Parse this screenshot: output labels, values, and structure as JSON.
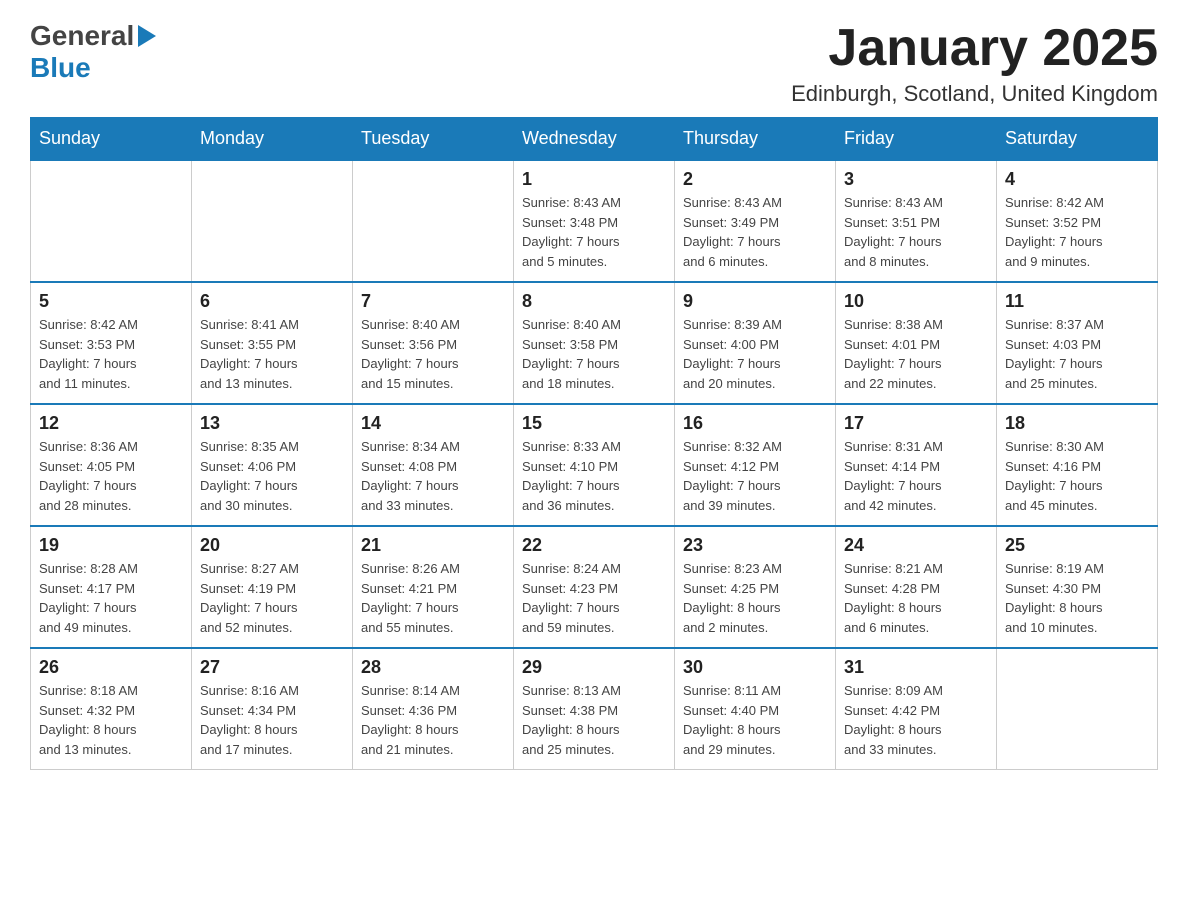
{
  "header": {
    "logo_general": "General",
    "logo_blue": "Blue",
    "title": "January 2025",
    "subtitle": "Edinburgh, Scotland, United Kingdom"
  },
  "days_of_week": [
    "Sunday",
    "Monday",
    "Tuesday",
    "Wednesday",
    "Thursday",
    "Friday",
    "Saturday"
  ],
  "weeks": [
    [
      {
        "day": "",
        "info": ""
      },
      {
        "day": "",
        "info": ""
      },
      {
        "day": "",
        "info": ""
      },
      {
        "day": "1",
        "info": "Sunrise: 8:43 AM\nSunset: 3:48 PM\nDaylight: 7 hours\nand 5 minutes."
      },
      {
        "day": "2",
        "info": "Sunrise: 8:43 AM\nSunset: 3:49 PM\nDaylight: 7 hours\nand 6 minutes."
      },
      {
        "day": "3",
        "info": "Sunrise: 8:43 AM\nSunset: 3:51 PM\nDaylight: 7 hours\nand 8 minutes."
      },
      {
        "day": "4",
        "info": "Sunrise: 8:42 AM\nSunset: 3:52 PM\nDaylight: 7 hours\nand 9 minutes."
      }
    ],
    [
      {
        "day": "5",
        "info": "Sunrise: 8:42 AM\nSunset: 3:53 PM\nDaylight: 7 hours\nand 11 minutes."
      },
      {
        "day": "6",
        "info": "Sunrise: 8:41 AM\nSunset: 3:55 PM\nDaylight: 7 hours\nand 13 minutes."
      },
      {
        "day": "7",
        "info": "Sunrise: 8:40 AM\nSunset: 3:56 PM\nDaylight: 7 hours\nand 15 minutes."
      },
      {
        "day": "8",
        "info": "Sunrise: 8:40 AM\nSunset: 3:58 PM\nDaylight: 7 hours\nand 18 minutes."
      },
      {
        "day": "9",
        "info": "Sunrise: 8:39 AM\nSunset: 4:00 PM\nDaylight: 7 hours\nand 20 minutes."
      },
      {
        "day": "10",
        "info": "Sunrise: 8:38 AM\nSunset: 4:01 PM\nDaylight: 7 hours\nand 22 minutes."
      },
      {
        "day": "11",
        "info": "Sunrise: 8:37 AM\nSunset: 4:03 PM\nDaylight: 7 hours\nand 25 minutes."
      }
    ],
    [
      {
        "day": "12",
        "info": "Sunrise: 8:36 AM\nSunset: 4:05 PM\nDaylight: 7 hours\nand 28 minutes."
      },
      {
        "day": "13",
        "info": "Sunrise: 8:35 AM\nSunset: 4:06 PM\nDaylight: 7 hours\nand 30 minutes."
      },
      {
        "day": "14",
        "info": "Sunrise: 8:34 AM\nSunset: 4:08 PM\nDaylight: 7 hours\nand 33 minutes."
      },
      {
        "day": "15",
        "info": "Sunrise: 8:33 AM\nSunset: 4:10 PM\nDaylight: 7 hours\nand 36 minutes."
      },
      {
        "day": "16",
        "info": "Sunrise: 8:32 AM\nSunset: 4:12 PM\nDaylight: 7 hours\nand 39 minutes."
      },
      {
        "day": "17",
        "info": "Sunrise: 8:31 AM\nSunset: 4:14 PM\nDaylight: 7 hours\nand 42 minutes."
      },
      {
        "day": "18",
        "info": "Sunrise: 8:30 AM\nSunset: 4:16 PM\nDaylight: 7 hours\nand 45 minutes."
      }
    ],
    [
      {
        "day": "19",
        "info": "Sunrise: 8:28 AM\nSunset: 4:17 PM\nDaylight: 7 hours\nand 49 minutes."
      },
      {
        "day": "20",
        "info": "Sunrise: 8:27 AM\nSunset: 4:19 PM\nDaylight: 7 hours\nand 52 minutes."
      },
      {
        "day": "21",
        "info": "Sunrise: 8:26 AM\nSunset: 4:21 PM\nDaylight: 7 hours\nand 55 minutes."
      },
      {
        "day": "22",
        "info": "Sunrise: 8:24 AM\nSunset: 4:23 PM\nDaylight: 7 hours\nand 59 minutes."
      },
      {
        "day": "23",
        "info": "Sunrise: 8:23 AM\nSunset: 4:25 PM\nDaylight: 8 hours\nand 2 minutes."
      },
      {
        "day": "24",
        "info": "Sunrise: 8:21 AM\nSunset: 4:28 PM\nDaylight: 8 hours\nand 6 minutes."
      },
      {
        "day": "25",
        "info": "Sunrise: 8:19 AM\nSunset: 4:30 PM\nDaylight: 8 hours\nand 10 minutes."
      }
    ],
    [
      {
        "day": "26",
        "info": "Sunrise: 8:18 AM\nSunset: 4:32 PM\nDaylight: 8 hours\nand 13 minutes."
      },
      {
        "day": "27",
        "info": "Sunrise: 8:16 AM\nSunset: 4:34 PM\nDaylight: 8 hours\nand 17 minutes."
      },
      {
        "day": "28",
        "info": "Sunrise: 8:14 AM\nSunset: 4:36 PM\nDaylight: 8 hours\nand 21 minutes."
      },
      {
        "day": "29",
        "info": "Sunrise: 8:13 AM\nSunset: 4:38 PM\nDaylight: 8 hours\nand 25 minutes."
      },
      {
        "day": "30",
        "info": "Sunrise: 8:11 AM\nSunset: 4:40 PM\nDaylight: 8 hours\nand 29 minutes."
      },
      {
        "day": "31",
        "info": "Sunrise: 8:09 AM\nSunset: 4:42 PM\nDaylight: 8 hours\nand 33 minutes."
      },
      {
        "day": "",
        "info": ""
      }
    ]
  ]
}
